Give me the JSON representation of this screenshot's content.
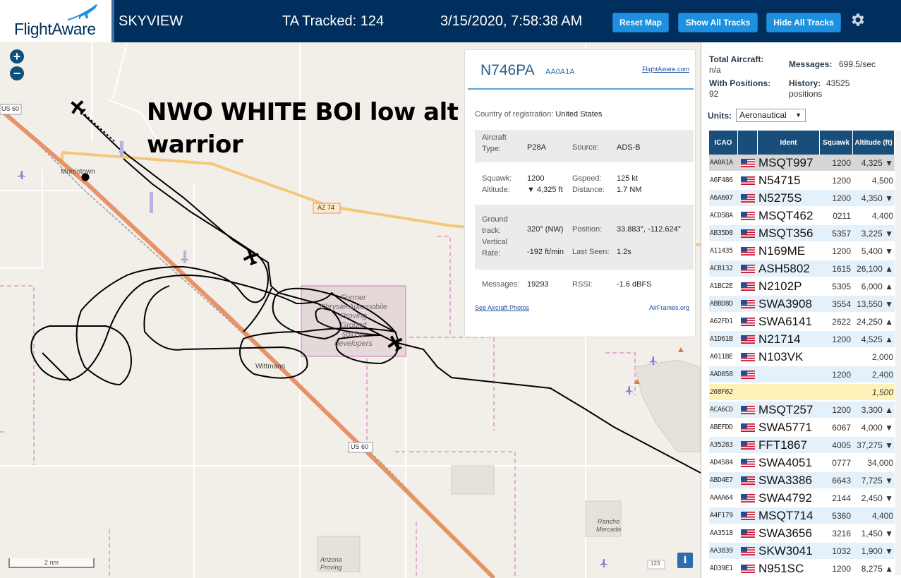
{
  "header": {
    "logo_text": "FlightAware",
    "app_title": "SKYVIEW",
    "tracked": "TA Tracked: 124",
    "datetime": "3/15/2020, 7:58:38 AM",
    "buttons": {
      "reset": "Reset Map",
      "show_all": "Show All Tracks",
      "hide_all": "Hide All Tracks"
    },
    "settings_icon": "gear-icon"
  },
  "map": {
    "zoom_in": "+",
    "zoom_out": "−",
    "annotation_line1": "NWO WHITE BOI low alt",
    "annotation_line2": "warrior",
    "scale_label": "2 nm",
    "info_button": "i",
    "labels": {
      "us60_a": "US 60",
      "us60_b": "US 60",
      "az74": "AZ 74",
      "morristown": "Morristown",
      "wittmann": "Wittmann",
      "former1": "Former",
      "former2": "ChryslerAutomobile",
      "former3": "Proving",
      "former4": "Ground",
      "former5": "sold to",
      "former6": "developers",
      "rancho1": "Rancho",
      "rancho2": "Mercado",
      "arizona1": "Arizona",
      "arizona2": "Proving",
      "road123": "123"
    },
    "colors": {
      "land": "#f2efe9",
      "highway": "#e8926a",
      "az74": "#f5c77a",
      "track": "#000000"
    }
  },
  "popup": {
    "registration": "N746PA",
    "hex": "AA0A1A",
    "fa_link": "FlightAware.com",
    "country_label": "Country of registration:",
    "country_value": "United States",
    "aircraft_label1": "Aircraft",
    "aircraft_label2": "Type:",
    "aircraft_type": "P28A",
    "source_label": "Source:",
    "source_value": "ADS-B",
    "squawk_label": "Squawk:",
    "squawk_value": "1200",
    "gspeed_label": "Gspeed:",
    "gspeed_value": "125 kt",
    "altitude_label": "Altitude:",
    "altitude_value": "▼ 4,325 ft",
    "distance_label": "Distance:",
    "distance_value": "1.7 NM",
    "ground_label1": "Ground",
    "ground_label2": "track:",
    "ground_value": "320° (NW)",
    "position_label": "Position:",
    "position_value": "33.883°, -112.624°",
    "vrate_label1": "Vertical",
    "vrate_label2": "Rate:",
    "vrate_value": "-192 ft/min",
    "lastseen_label": "Last Seen:",
    "lastseen_value": "1.2s",
    "messages_label": "Messages:",
    "messages_value": "19293",
    "rssi_label": "RSSI:",
    "rssi_value": "-1.6 dBFS",
    "photos_link": "See Aircraft Photos",
    "airframes_link": "AirFrames.org"
  },
  "sidebar": {
    "total_label": "Total Aircraft:",
    "total_value": "n/a",
    "messages_label": "Messages:",
    "messages_value": "699.5/sec",
    "withpos_label": "With Positions:",
    "withpos_value": "92",
    "history_label": "History:",
    "history_value": "43525",
    "history_unit": "positions",
    "units_label": "Units:",
    "units_value": "Aeronautical",
    "columns": [
      "ICAO",
      "",
      "Ident",
      "Squawk",
      "Altitude (ft)"
    ],
    "rows": [
      {
        "icao": "AA0A1A",
        "ident": "MSQT997",
        "squawk": "1200",
        "alt": "4,325 ▼"
      },
      {
        "icao": "A6F486",
        "ident": "N54715",
        "squawk": "1200",
        "alt": "4,500"
      },
      {
        "icao": "A6A607",
        "ident": "N5275S",
        "squawk": "1200",
        "alt": "4,350 ▼"
      },
      {
        "icao": "ACD5BA",
        "ident": "MSQT462",
        "squawk": "0211",
        "alt": "4,400"
      },
      {
        "icao": "AB35D8",
        "ident": "MSQT356",
        "squawk": "5357",
        "alt": "3,225 ▼"
      },
      {
        "icao": "A11435",
        "ident": "N169ME",
        "squawk": "1200",
        "alt": "5,400 ▼"
      },
      {
        "icao": "ACB132",
        "ident": "ASH5802",
        "squawk": "1615",
        "alt": "26,100 ▲"
      },
      {
        "icao": "A1BC2E",
        "ident": "N2102P",
        "squawk": "5305",
        "alt": "6,000 ▲"
      },
      {
        "icao": "ABBD8D",
        "ident": "SWA3908",
        "squawk": "3554",
        "alt": "13,550 ▼"
      },
      {
        "icao": "A62FD1",
        "ident": "SWA6141",
        "squawk": "2622",
        "alt": "24,250 ▲"
      },
      {
        "icao": "A1D61B",
        "ident": "N21714",
        "squawk": "1200",
        "alt": "4,525 ▲"
      },
      {
        "icao": "A011BE",
        "ident": "N103VK",
        "squawk": "",
        "alt": "2,000"
      },
      {
        "icao": "AAD058",
        "ident": "",
        "squawk": "1200",
        "alt": "2,400"
      },
      {
        "icao": "268F62",
        "ident": "",
        "squawk": "",
        "alt": "1,500"
      },
      {
        "icao": "ACA6CD",
        "ident": "MSQT257",
        "squawk": "1200",
        "alt": "3,300 ▲"
      },
      {
        "icao": "ABEFDD",
        "ident": "SWA5771",
        "squawk": "6067",
        "alt": "4,000 ▼"
      },
      {
        "icao": "A35283",
        "ident": "FFT1867",
        "squawk": "4005",
        "alt": "37,275 ▼"
      },
      {
        "icao": "AD4584",
        "ident": "SWA4051",
        "squawk": "0777",
        "alt": "34,000"
      },
      {
        "icao": "ABD4E7",
        "ident": "SWA3386",
        "squawk": "6643",
        "alt": "7,725 ▼"
      },
      {
        "icao": "AAAA64",
        "ident": "SWA4792",
        "squawk": "2144",
        "alt": "2,450 ▼"
      },
      {
        "icao": "A4F179",
        "ident": "MSQT714",
        "squawk": "5360",
        "alt": "4,400"
      },
      {
        "icao": "AA3518",
        "ident": "SWA3656",
        "squawk": "3216",
        "alt": "1,450 ▼"
      },
      {
        "icao": "AA3839",
        "ident": "SKW3041",
        "squawk": "1032",
        "alt": "1,900 ▼"
      },
      {
        "icao": "AD39E1",
        "ident": "N951SC",
        "squawk": "1200",
        "alt": "8,275 ▲"
      }
    ]
  }
}
